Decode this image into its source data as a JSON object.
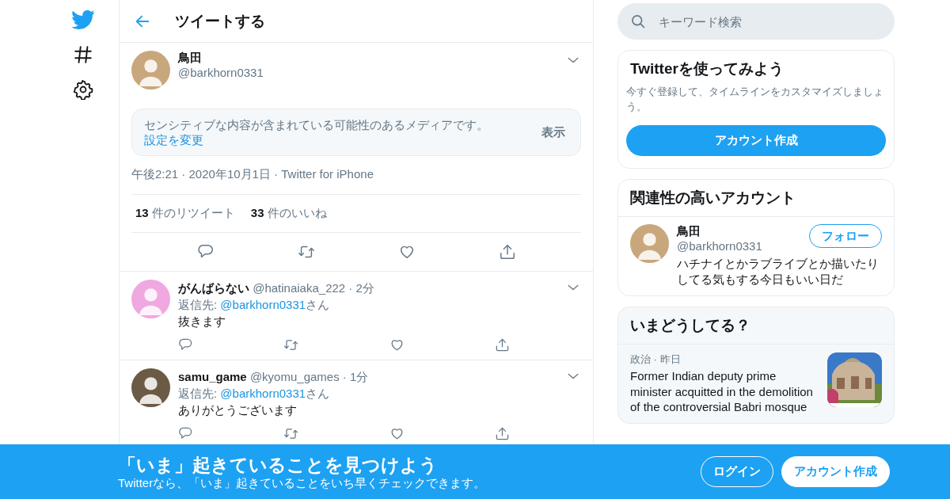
{
  "header": {
    "title": "ツイートする"
  },
  "tweet": {
    "name": "鳥田",
    "handle": "@barkhorn0331",
    "notice": "センシティブな内容が含まれている可能性のあるメディアです。",
    "notice_link": "設定を変更",
    "show_button": "表示",
    "meta": "午後2:21 · 2020年10月1日 · Twitter for iPhone",
    "stats": [
      {
        "count": "13",
        "label": "件のリツイート"
      },
      {
        "count": "33",
        "label": "件のいいね"
      }
    ]
  },
  "replies": [
    {
      "name": "がんばらない",
      "handle": "@hatinaiaka_222 · 2分",
      "reply_prefix": "返信先: ",
      "reply_to": "@barkhorn0331",
      "reply_suffix": "さん",
      "text": "抜きます"
    },
    {
      "name": "samu_game",
      "handle": "@kyomu_games · 1分",
      "reply_prefix": "返信先: ",
      "reply_to": "@barkhorn0331",
      "reply_suffix": "さん",
      "text": "ありがとうございます"
    }
  ],
  "search": {
    "placeholder": "キーワード検索"
  },
  "signup_card": {
    "title": "Twitterを使ってみよう",
    "text": "今すぐ登録して、タイムラインをカスタマイズしましょう。",
    "button": "アカウント作成"
  },
  "who_to_follow": {
    "title": "関連性の高いアカウント",
    "accounts": [
      {
        "name": "鳥田",
        "handle": "@barkhorn0331",
        "button": "フォロー",
        "bio": "ハチナイとかラブライブとか描いたりしてる気もする今日もいい日だ"
      }
    ]
  },
  "trends": {
    "title": "いまどうしてる？",
    "items": [
      {
        "meta": "政治 · 昨日",
        "headline": "Former Indian deputy prime minister acquitted in the demolition of the controversial Babri mosque",
        "kind": "picture"
      }
    ]
  },
  "banner": {
    "title": "「いま」起きていることを見つけよう",
    "subtitle": "Twitterなら、「いま」起きていることをいち早くチェックできます。",
    "login": "ログイン",
    "signup": "アカウント作成"
  }
}
